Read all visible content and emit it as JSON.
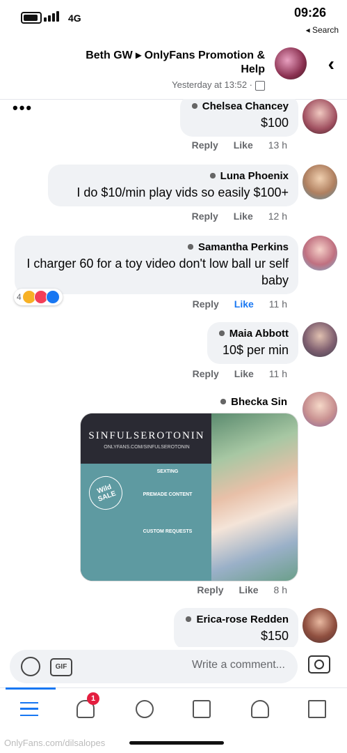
{
  "status": {
    "time": "09:26",
    "network": "4G",
    "back_label": "◂ Search"
  },
  "header": {
    "title": "Beth GW ▸ OnlyFans Promotion & Help",
    "subtitle": "Yesterday at 13:52 ·"
  },
  "comments": [
    {
      "name": "Chelsea Chancey",
      "message": "$100",
      "time": "13 h",
      "like": "Like",
      "reply": "Reply"
    },
    {
      "name": "Luna Phoenix",
      "message": "I do $10/min play vids so easily $100+",
      "time": "12 h",
      "like": "Like",
      "reply": "Reply"
    },
    {
      "name": "Samantha Perkins",
      "message": "I charger 60 for a toy video don't low ball ur self baby",
      "time": "11 h",
      "like": "Like",
      "reply": "Reply",
      "reaction_count": "4"
    },
    {
      "name": "Maia Abbott",
      "message": "10$ per min",
      "time": "11 h",
      "like": "Like",
      "reply": "Reply"
    },
    {
      "name": "Bhecka Sin",
      "time": "8 h",
      "like": "Like",
      "reply": "Reply",
      "image": {
        "brand": "SINFULSEROTONIN",
        "url": "ONLYFANS.COM/SINFULSEROTONIN",
        "sale": "Wild SALE",
        "sections": [
          "SEXTING",
          "PREMADE CONTENT",
          "CUSTOM REQUESTS"
        ]
      }
    },
    {
      "name": "Erica-rose Redden",
      "message": "$150"
    }
  ],
  "composer": {
    "placeholder": "Write a comment...",
    "gif_label": "GIF"
  },
  "tabbar": {
    "notifications_badge": "1"
  },
  "watermark": "OnlyFans.com/dilsalopes"
}
